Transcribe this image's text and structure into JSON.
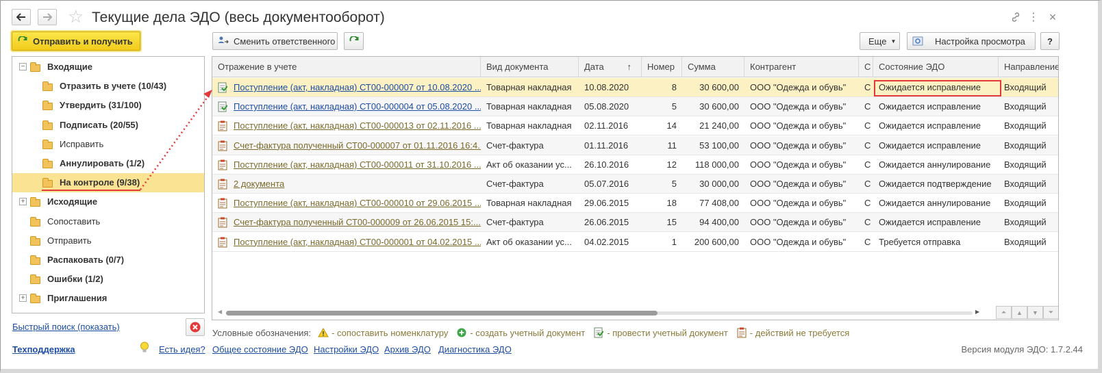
{
  "window": {
    "title": "Текущие дела ЭДО (весь документооборот)",
    "icons": [
      "back-arrow-icon",
      "forward-arrow-icon",
      "star-icon",
      "link-icon",
      "more-vertical-icon",
      "close-icon"
    ]
  },
  "toolbar": {
    "send_receive": "Отправить и получить",
    "change_responsible": "Сменить ответственного",
    "more": "Еще",
    "view_settings": "Настройка просмотра",
    "help": "?"
  },
  "tree": [
    {
      "label": "Входящие",
      "bold": true,
      "level": 0,
      "expander": "minus"
    },
    {
      "label": "Отразить в учете (10/43)",
      "bold": true,
      "level": 1
    },
    {
      "label": "Утвердить (31/100)",
      "bold": true,
      "level": 1
    },
    {
      "label": "Подписать (20/55)",
      "bold": true,
      "level": 1
    },
    {
      "label": "Исправить",
      "bold": false,
      "level": 1
    },
    {
      "label": "Аннулировать (1/2)",
      "bold": true,
      "level": 1
    },
    {
      "label": "На контроле (9/38)",
      "bold": true,
      "level": 1,
      "selected": true
    },
    {
      "label": "Исходящие",
      "bold": true,
      "level": 0,
      "expander": "plus"
    },
    {
      "label": "Сопоставить",
      "bold": false,
      "level": 0
    },
    {
      "label": "Отправить",
      "bold": false,
      "level": 0
    },
    {
      "label": "Распаковать (0/7)",
      "bold": true,
      "level": 0
    },
    {
      "label": "Ошибки (1/2)",
      "bold": true,
      "level": 0
    },
    {
      "label": "Приглашения",
      "bold": true,
      "level": 0,
      "expander": "plus"
    }
  ],
  "grid": {
    "columns": [
      "Отражение в учете",
      "Вид документа",
      "Дата",
      "Номер",
      "Сумма",
      "Контрагент",
      "С",
      "Состояние ЭДО",
      "Направление"
    ],
    "sort_indicator": "↑",
    "rows": [
      {
        "doc": "Поступление (акт, накладная) СТ00-000007 от 10.08.2020 ...",
        "kind": "Товарная накладная",
        "date": "10.08.2020",
        "num": "8",
        "sum": "30 600,00",
        "partner": "ООО \"Одежда и обувь\"",
        "c": "С",
        "state": "Ожидается исправление",
        "dir": "Входящий",
        "icon": "post",
        "link": "blue"
      },
      {
        "doc": "Поступление (акт, накладная) СТ00-000004 от 05.08.2020 ...",
        "kind": "Товарная накладная",
        "date": "05.08.2020",
        "num": "5",
        "sum": "30 600,00",
        "partner": "ООО \"Одежда и обувь\"",
        "c": "С",
        "state": "Ожидается исправление",
        "dir": "Входящий",
        "icon": "post",
        "link": "blue"
      },
      {
        "doc": "Поступление (акт, накладная) СТ00-000013 от 02.11.2016 ...",
        "kind": "Товарная накладная",
        "date": "02.11.2016",
        "num": "14",
        "sum": "21 240,00",
        "partner": "ООО \"Одежда и обувь\"",
        "c": "С",
        "state": "Ожидается исправление",
        "dir": "Входящий",
        "icon": "clip",
        "link": "olive"
      },
      {
        "doc": "Счет-фактура полученный СТ00-000007 от 01.11.2016 16:4...",
        "kind": "Счет-фактура",
        "date": "01.11.2016",
        "num": "11",
        "sum": "53 100,00",
        "partner": "ООО \"Одежда и обувь\"",
        "c": "С",
        "state": "Ожидается исправление",
        "dir": "Входящий",
        "icon": "clip",
        "link": "olive"
      },
      {
        "doc": "Поступление (акт, накладная) СТ00-000011 от 31.10.2016 ...",
        "kind": "Акт об оказании ус...",
        "date": "26.10.2016",
        "num": "12",
        "sum": "118 000,00",
        "partner": "ООО \"Одежда и обувь\"",
        "c": "С",
        "state": "Ожидается аннулирование",
        "dir": "Входящий",
        "icon": "clip",
        "link": "olive"
      },
      {
        "doc": "2 документа",
        "kind": "Счет-фактура",
        "date": "05.07.2016",
        "num": "5",
        "sum": "30 000,00",
        "partner": "ООО \"Одежда и обувь\"",
        "c": "С",
        "state": "Ожидается подтверждение",
        "dir": "Входящий",
        "icon": "clip",
        "link": "olive"
      },
      {
        "doc": "Поступление (акт, накладная) СТ00-000010 от 29.06.2015 ...",
        "kind": "Товарная накладная",
        "date": "29.06.2015",
        "num": "18",
        "sum": "77 408,00",
        "partner": "ООО \"Одежда и обувь\"",
        "c": "С",
        "state": "Ожидается аннулирование",
        "dir": "Входящий",
        "icon": "clip",
        "link": "olive"
      },
      {
        "doc": "Счет-фактура полученный СТ00-000009 от 26.06.2015 15:...",
        "kind": "Счет-фактура",
        "date": "26.06.2015",
        "num": "15",
        "sum": "94 400,00",
        "partner": "ООО \"Одежда и обувь\"",
        "c": "С",
        "state": "Ожидается исправление",
        "dir": "Входящий",
        "icon": "clip",
        "link": "olive"
      },
      {
        "doc": "Поступление (акт, накладная) СТ00-000001 от 04.02.2015 ...",
        "kind": "Акт об оказании ус...",
        "date": "04.02.2015",
        "num": "1",
        "sum": "200 600,00",
        "partner": "ООО \"Одежда и обувь\"",
        "c": "С",
        "state": "Требуется отправка",
        "dir": "Входящий",
        "icon": "clip",
        "link": "olive"
      }
    ]
  },
  "legend": {
    "caption": "Условные обозначения:",
    "items": [
      {
        "icon": "warning-icon",
        "text": "- сопоставить номенклатуру"
      },
      {
        "icon": "plus-circle-icon",
        "text": "- создать учетный документ"
      },
      {
        "icon": "post-document-icon",
        "text": "- провести учетный документ"
      },
      {
        "icon": "no-action-document-icon",
        "text": "- действий не требуется"
      }
    ]
  },
  "footer": {
    "quick_search": "Быстрый поиск (показать)",
    "support": "Техподдержка",
    "idea": "Есть идея?",
    "general_state": "Общее состояние ЭДО",
    "settings": "Настройки ЭДО",
    "archive": "Архив ЭДО",
    "diagnostics": "Диагностика ЭДО",
    "version": "Версия модуля ЭДО: 1.7.2.44"
  },
  "colors": {
    "accent_yellow": "#f2cc1c",
    "selection": "#fbe394",
    "link_blue": "#1d4ea5",
    "link_olive": "#7b6a2a",
    "highlight_red": "#e23a3a"
  }
}
